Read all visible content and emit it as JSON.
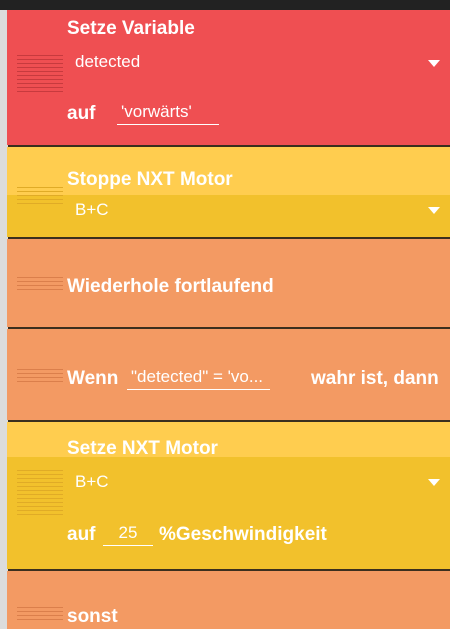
{
  "bricks": {
    "set_variable": {
      "title": "Setze Variable",
      "variable": "detected",
      "to_label": "auf",
      "value": "'vorwärts'"
    },
    "stop_motor": {
      "title": "Stoppe NXT Motor",
      "motors": "B+C"
    },
    "forever": {
      "title": "Wiederhole fortlaufend"
    },
    "if_brick": {
      "prefix": "Wenn",
      "condition": "\"detected\" = 'vo...",
      "suffix": "wahr ist, dann"
    },
    "set_motor": {
      "title": "Setze NXT Motor",
      "motors": "B+C",
      "to_label": "auf",
      "speed": "25",
      "unit": "%Geschwindigkeit"
    },
    "else_brick": {
      "title": "sonst"
    }
  },
  "colors": {
    "control_red": "#ef4f52",
    "motor_yellow": "#ffcd4f",
    "loop_orange": "#f39a63"
  }
}
